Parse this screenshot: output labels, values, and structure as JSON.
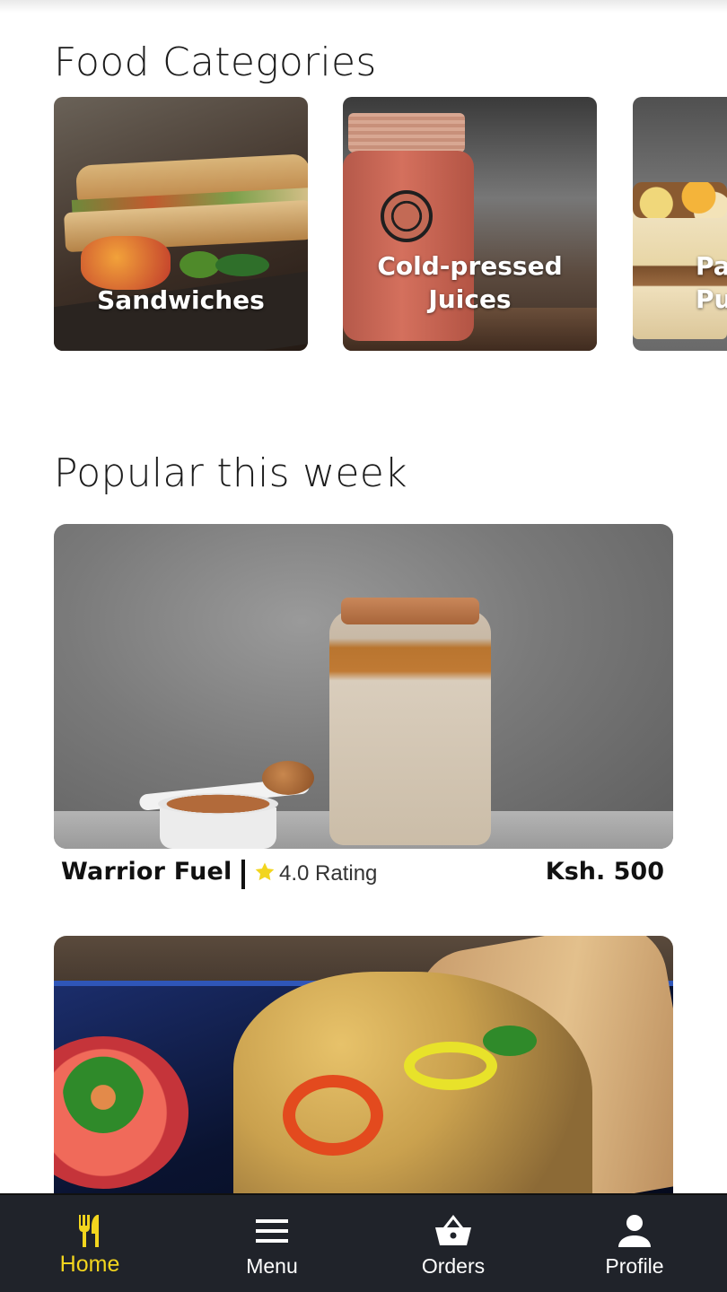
{
  "sections": {
    "categories_title": "Food Categories",
    "popular_title": "Popular this week"
  },
  "categories": [
    {
      "label": "Sandwiches"
    },
    {
      "label_line1": "Cold-pressed",
      "label_line2": "Juices"
    },
    {
      "label_line1": "Pa",
      "label_line2": "Pu"
    }
  ],
  "popular": [
    {
      "name": "Warrior Fuel",
      "rating_text": "4.0 Rating",
      "rating": 4.0,
      "price": "Ksh. 500"
    }
  ],
  "nav": {
    "home": "Home",
    "menu": "Menu",
    "orders": "Orders",
    "profile": "Profile",
    "active": "home"
  },
  "colors": {
    "accent": "#f2d51e",
    "nav_bg": "#20232a",
    "star": "#f2d51e"
  },
  "icons": [
    "fork-knife-icon",
    "hamburger-menu-icon",
    "basket-icon",
    "person-icon",
    "star-icon"
  ]
}
